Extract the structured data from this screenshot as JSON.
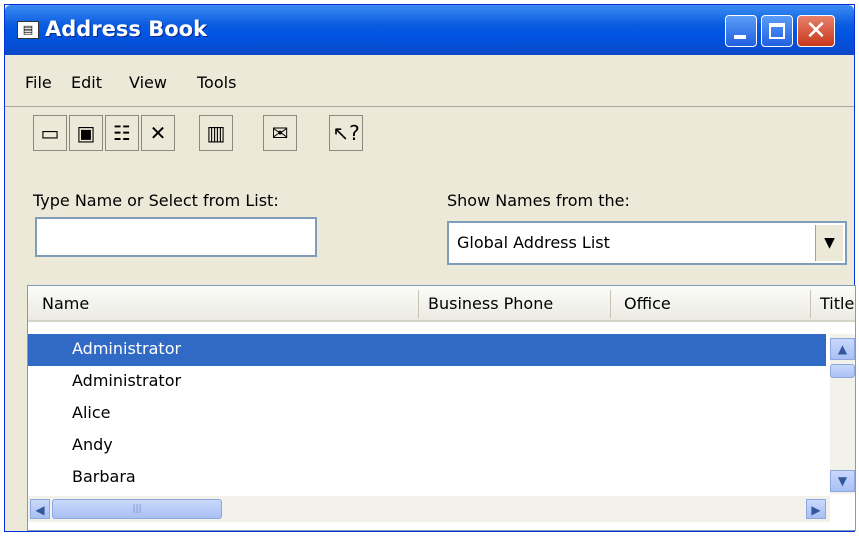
{
  "window": {
    "title": "Address Book"
  },
  "menubar": {
    "items": [
      "File",
      "Edit",
      "View",
      "Tools"
    ]
  },
  "form": {
    "search_label": "Type Name or Select from List:",
    "search_value": "",
    "source_label": "Show Names from the:",
    "source_value": "Global Address List"
  },
  "list": {
    "columns": [
      "Name",
      "Business Phone",
      "Office",
      "Title"
    ],
    "rows": [
      "Administrator",
      "Administrator",
      "Alice",
      "Andy",
      "Barbara"
    ],
    "selected_index": 0
  },
  "colors": {
    "title_bar": "#0054e3",
    "selection": "#316ac5",
    "face": "#ece9d8"
  }
}
